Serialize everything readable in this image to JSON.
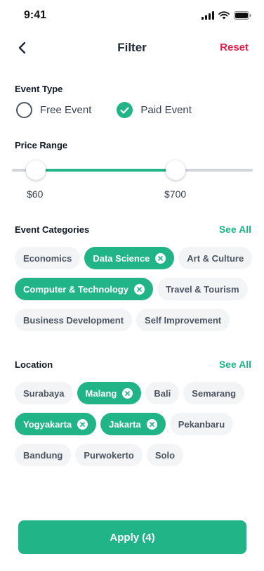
{
  "status": {
    "time": "9:41"
  },
  "nav": {
    "title": "Filter",
    "reset_label": "Reset"
  },
  "event_type": {
    "title": "Event Type",
    "options": [
      {
        "label": "Free Event",
        "selected": false
      },
      {
        "label": "Paid Event",
        "selected": true
      }
    ]
  },
  "price_range": {
    "title": "Price Range",
    "min_label": "$60",
    "max_label": "$700",
    "min_fraction": 0.1,
    "max_fraction": 0.68
  },
  "categories": {
    "title": "Event Categories",
    "see_all": "See All",
    "items": [
      {
        "label": "Economics",
        "selected": false
      },
      {
        "label": "Data Science",
        "selected": true
      },
      {
        "label": "Art & Culture",
        "selected": false
      },
      {
        "label": "Computer & Technology",
        "selected": true
      },
      {
        "label": "Travel & Tourism",
        "selected": false
      },
      {
        "label": "Business Development",
        "selected": false
      },
      {
        "label": "Self Improvement",
        "selected": false
      }
    ]
  },
  "location": {
    "title": "Location",
    "see_all": "See All",
    "items": [
      {
        "label": "Surabaya",
        "selected": false
      },
      {
        "label": "Malang",
        "selected": true
      },
      {
        "label": "Bali",
        "selected": false
      },
      {
        "label": "Semarang",
        "selected": false
      },
      {
        "label": "Yogyakarta",
        "selected": true
      },
      {
        "label": "Jakarta",
        "selected": true
      },
      {
        "label": "Pekanbaru",
        "selected": false
      },
      {
        "label": "Bandung",
        "selected": false
      },
      {
        "label": "Purwokerto",
        "selected": false
      },
      {
        "label": "Solo",
        "selected": false
      }
    ]
  },
  "apply_label": "Apply (4)",
  "colors": {
    "accent": "#20b486",
    "reset": "#e11d48",
    "chip_bg": "#f3f4f6"
  }
}
